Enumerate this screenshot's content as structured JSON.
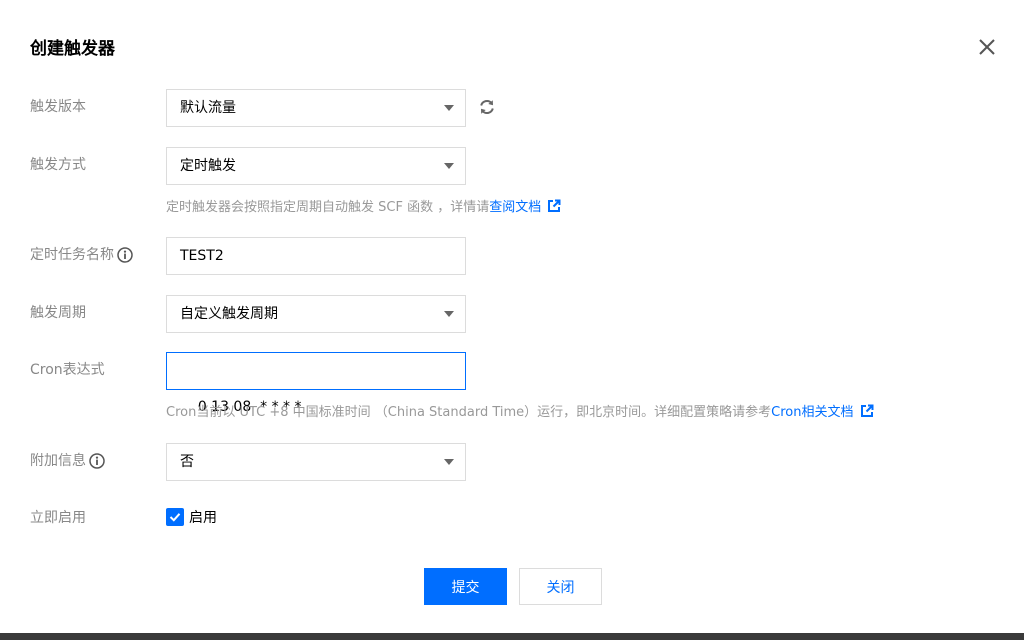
{
  "dialog": {
    "title": "创建触发器",
    "close_icon": "close-icon"
  },
  "form": {
    "version": {
      "label": "触发版本",
      "value": "默认流量"
    },
    "method": {
      "label": "触发方式",
      "value": "定时触发",
      "help_text": "定时触发器会按照指定周期自动触发 SCF 函数 ，详情请",
      "help_link": "查阅文档"
    },
    "task_name": {
      "label": "定时任务名称",
      "value": "TEST2"
    },
    "period": {
      "label": "触发周期",
      "value": "自定义触发周期"
    },
    "cron": {
      "label": "Cron表达式",
      "value": "0 13 08  * * * *",
      "help_text": "Cron当前以 UTC +8 中国标准时间 （China Standard Time）运行，即北京时间。详细配置策略请参考",
      "help_link": "Cron相关文档"
    },
    "extra_info": {
      "label": "附加信息",
      "value": "否"
    },
    "enable_now": {
      "label": "立即启用",
      "checkbox_label": "启用",
      "checked": true
    }
  },
  "buttons": {
    "submit": "提交",
    "close": "关闭"
  },
  "colors": {
    "primary": "#006eff",
    "label": "#888888",
    "border": "#dcdcdc"
  }
}
